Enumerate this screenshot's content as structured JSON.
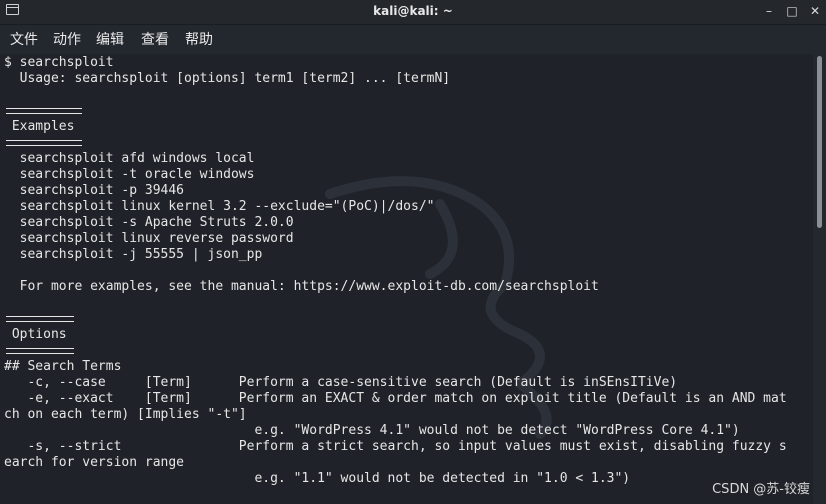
{
  "window": {
    "title": "kali@kali: ~",
    "minimize_glyph": "–",
    "maximize_glyph": "□",
    "close_glyph": "✕",
    "icon": "terminal-icon"
  },
  "menu": {
    "items": [
      "文件",
      "动作",
      "编辑",
      "查看",
      "帮助"
    ]
  },
  "terminal": {
    "lines": [
      "$ searchsploit",
      "  Usage: searchsploit [options] term1 [term2] ... [termN]",
      "",
      "",
      " Examples",
      "",
      "  searchsploit afd windows local",
      "  searchsploit -t oracle windows",
      "  searchsploit -p 39446",
      "  searchsploit linux kernel 3.2 --exclude=\"(PoC)|/dos/\"",
      "  searchsploit -s Apache Struts 2.0.0",
      "  searchsploit linux reverse password",
      "  searchsploit -j 55555 | json_pp",
      "",
      "  For more examples, see the manual: https://www.exploit-db.com/searchsploit",
      "",
      "",
      " Options",
      "",
      "## Search Terms",
      "   -c, --case     [Term]      Perform a case-sensitive search (Default is inSEnsITiVe)",
      "   -e, --exact    [Term]      Perform an EXACT & order match on exploit title (Default is an AND mat",
      "ch on each term) [Implies \"-t\"]",
      "                                e.g. \"WordPress 4.1\" would not be detect \"WordPress Core 4.1\")",
      "   -s, --strict               Perform a strict search, so input values must exist, disabling fuzzy s",
      "earch for version range",
      "                                e.g. \"1.1\" would not be detected in \"1.0 < 1.3\")"
    ]
  },
  "watermark": "CSDN @苏-铰瘦",
  "colors": {
    "background": "#1f2228",
    "text": "#e6e6e6",
    "chrome": "#23272e"
  }
}
